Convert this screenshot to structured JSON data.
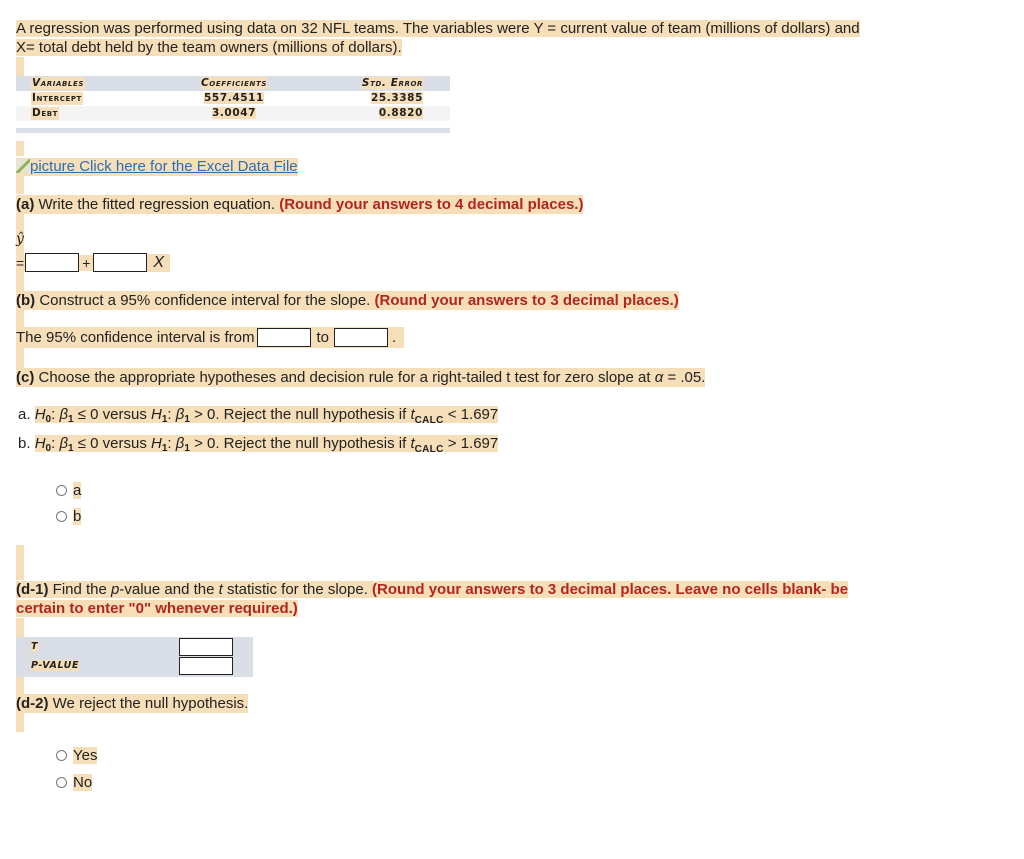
{
  "intro": {
    "line1": "A regression was performed using data on 32 NFL teams. The variables were Y = current value of team (millions of dollars) and",
    "line2": "X= total debt held by the team owners (millions of dollars)."
  },
  "regression_table": {
    "headers": [
      "Variables",
      "Coefficients",
      "Std. Error"
    ],
    "rows": [
      {
        "variable": "Intercept",
        "coefficient": "557.4511",
        "std_error": "25.3385"
      },
      {
        "variable": "Debt",
        "coefficient": "3.0047",
        "std_error": "0.8820"
      }
    ]
  },
  "data_link": {
    "alt_text": "picture",
    "label": "Click here for the Excel Data File"
  },
  "part_a": {
    "tag": "(a)",
    "text": " Write the fitted regression equation. ",
    "instruction": "(Round your answers to 4 decimal places.)",
    "yhat": "ŷ",
    "equals": "=",
    "plus": "+",
    "x_symbol": "X",
    "intercept_value": "",
    "slope_value": ""
  },
  "part_b": {
    "tag": "(b)",
    "text": " Construct a 95% confidence interval for the slope. ",
    "instruction": "(Round your answers to 3 decimal places.)",
    "sentence_start": "The 95% confidence interval is from",
    "to": "to",
    "end": ".",
    "lower_value": "",
    "upper_value": ""
  },
  "part_c": {
    "tag": "(c)",
    "text": " Choose the appropriate hypotheses and decision rule for a right-tailed t test for zero slope at ",
    "alpha_symbol": "α",
    "alpha_value": " = .05.",
    "options": [
      {
        "letter": "a.",
        "h0": "H",
        "h0_sub": "0",
        "beta": "β",
        "beta_sub": "1",
        "h0_rel": " ≤ 0 versus ",
        "h1": "H",
        "h1_sub": "1",
        "h1_rel": " > 0. Reject the null hypothesis if ",
        "t": "t",
        "t_sub": "CALC",
        "rule": " < 1.697"
      },
      {
        "letter": "b.",
        "h0": "H",
        "h0_sub": "0",
        "beta": "β",
        "beta_sub": "1",
        "h0_rel": " ≤ 0 versus ",
        "h1": "H",
        "h1_sub": "1",
        "h1_rel": " > 0. Reject the null hypothesis if ",
        "t": "t",
        "t_sub": "CALC",
        "rule": " > 1.697"
      }
    ],
    "choices": [
      "a",
      "b"
    ],
    "selected": null
  },
  "part_d1": {
    "tag": "(d-1)",
    "text_1": " Find the ",
    "p": "p",
    "text_2": "-value and the ",
    "t": "t",
    "text_3": " statistic for the slope. ",
    "instruction_line1": "(Round your answers to 3 decimal places. Leave no cells blank- be",
    "instruction_line2": "certain to enter \"0\" whenever required.)",
    "rows": [
      {
        "label": "T",
        "value": ""
      },
      {
        "label": "P-VALUE",
        "value": ""
      }
    ]
  },
  "part_d2": {
    "tag": "(d-2)",
    "text": " We reject the null hypothesis.",
    "choices": [
      "Yes",
      "No"
    ],
    "selected": null
  }
}
